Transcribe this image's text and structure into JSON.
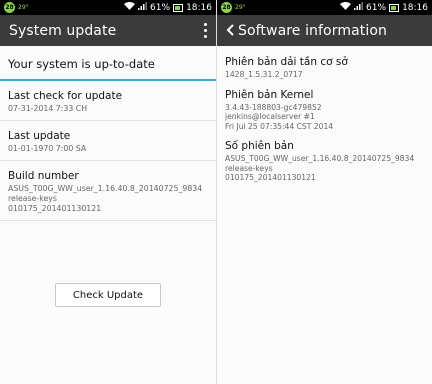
{
  "status_bar": {
    "badge": "28",
    "temp": "29°",
    "battery": "61%",
    "time": "18:16"
  },
  "left": {
    "title": "System update",
    "status": "Your system is up-to-date",
    "items": [
      {
        "label": "Last check for update",
        "values": [
          "07-31-2014 7:33 CH"
        ]
      },
      {
        "label": "Last update",
        "values": [
          "01-01-1970 7:00 SA"
        ]
      },
      {
        "label": "Build number",
        "values": [
          "ASUS_T00G_WW_user_1.16.40.8_20140725_9834",
          "release-keys",
          "010175_201401130121"
        ]
      }
    ],
    "button": "Check Update"
  },
  "right": {
    "title": "Software information",
    "items": [
      {
        "label": "Phiên bản dải tần cơ sở",
        "values": [
          "1428_1.5.31.2_0717"
        ]
      },
      {
        "label": "Phiên bản Kernel",
        "values": [
          "3.4.43-188803-gc479852",
          "jenkins@localserver #1",
          "Fri Jul 25 07:35:44 CST 2014"
        ]
      },
      {
        "label": "Số phiên bản",
        "values": [
          "ASUS_T00G_WW_user_1.16.40.8_20140725_9834",
          "release-keys",
          "010175_201401130121"
        ]
      }
    ]
  },
  "icons": [
    "wifi-icon",
    "signal-icon",
    "battery-icon",
    "overflow-menu-icon",
    "back-arrow-icon"
  ]
}
